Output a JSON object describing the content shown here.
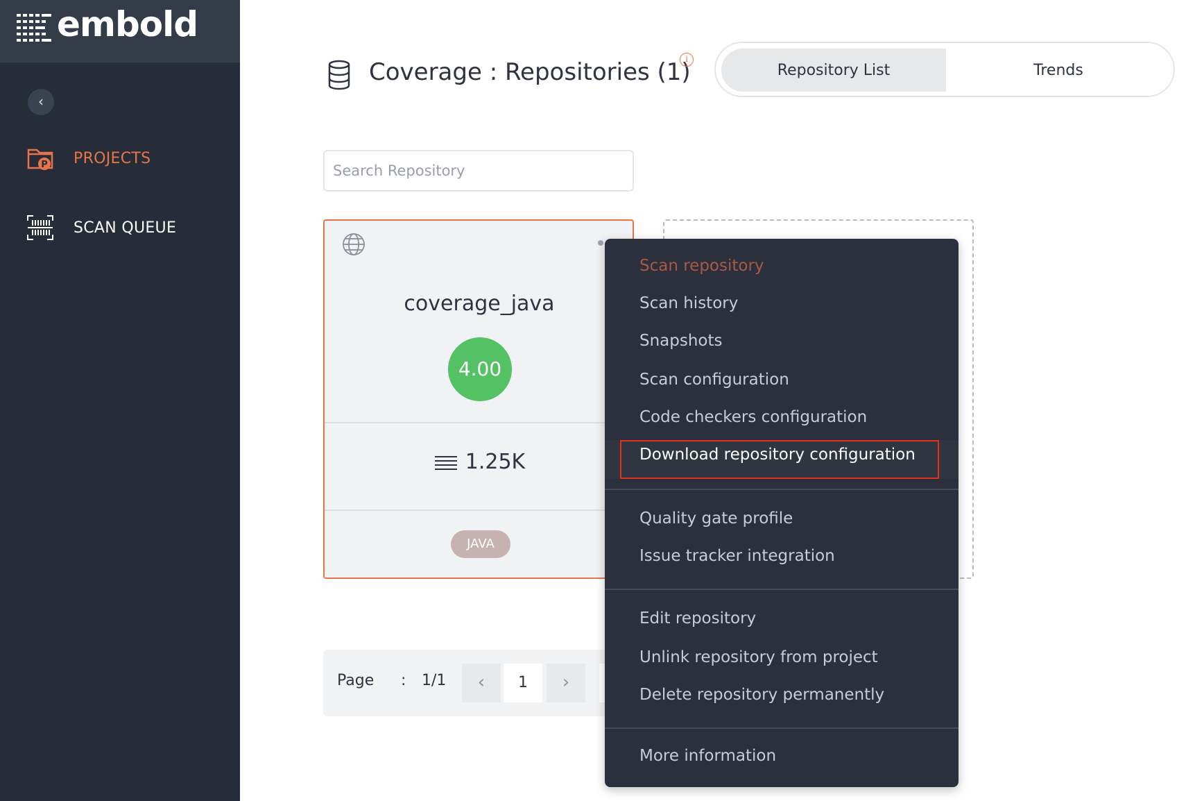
{
  "app": {
    "logo_text": "embold"
  },
  "sidebar": {
    "collapse_glyph": "‹",
    "items": [
      {
        "label": "PROJECTS",
        "icon": "projects-folder-icon",
        "active": true,
        "color": "#e8744a"
      },
      {
        "label": "SCAN QUEUE",
        "icon": "scan-queue-icon",
        "active": false,
        "color": "#ffffff"
      }
    ]
  },
  "header": {
    "title": "Coverage : Repositories (1)",
    "info_glyph": "i",
    "tabs": [
      {
        "label": "Repository List",
        "active": true
      },
      {
        "label": "Trends",
        "active": false
      }
    ]
  },
  "search": {
    "placeholder": "Search Repository",
    "value": ""
  },
  "repository_card": {
    "name": "coverage_java",
    "score": "4.00",
    "score_color": "#54c264",
    "loc": "1.25K",
    "language": "JAVA"
  },
  "pagination": {
    "label": "Page",
    "separator": ":",
    "count": "1/1",
    "current_page": "1",
    "prev_glyph": "‹",
    "next_glyph": "›"
  },
  "context_menu": {
    "groups": [
      [
        {
          "label": "Scan repository",
          "state": "active"
        },
        {
          "label": "Scan history"
        },
        {
          "label": "Snapshots"
        },
        {
          "label": "Scan configuration"
        },
        {
          "label": "Code checkers configuration"
        },
        {
          "label": "Download repository configuration",
          "state": "highlighted"
        }
      ],
      [
        {
          "label": "Quality gate profile"
        },
        {
          "label": "Issue tracker integration"
        }
      ],
      [
        {
          "label": "Edit repository"
        },
        {
          "label": "Unlink repository from project"
        },
        {
          "label": "Delete repository permanently"
        }
      ],
      [
        {
          "label": "More information"
        }
      ]
    ]
  },
  "colors": {
    "sidebar_bg": "#272d38",
    "accent": "#e8744a",
    "menu_bg": "#2b303c",
    "highlight_border": "#e0331f"
  }
}
